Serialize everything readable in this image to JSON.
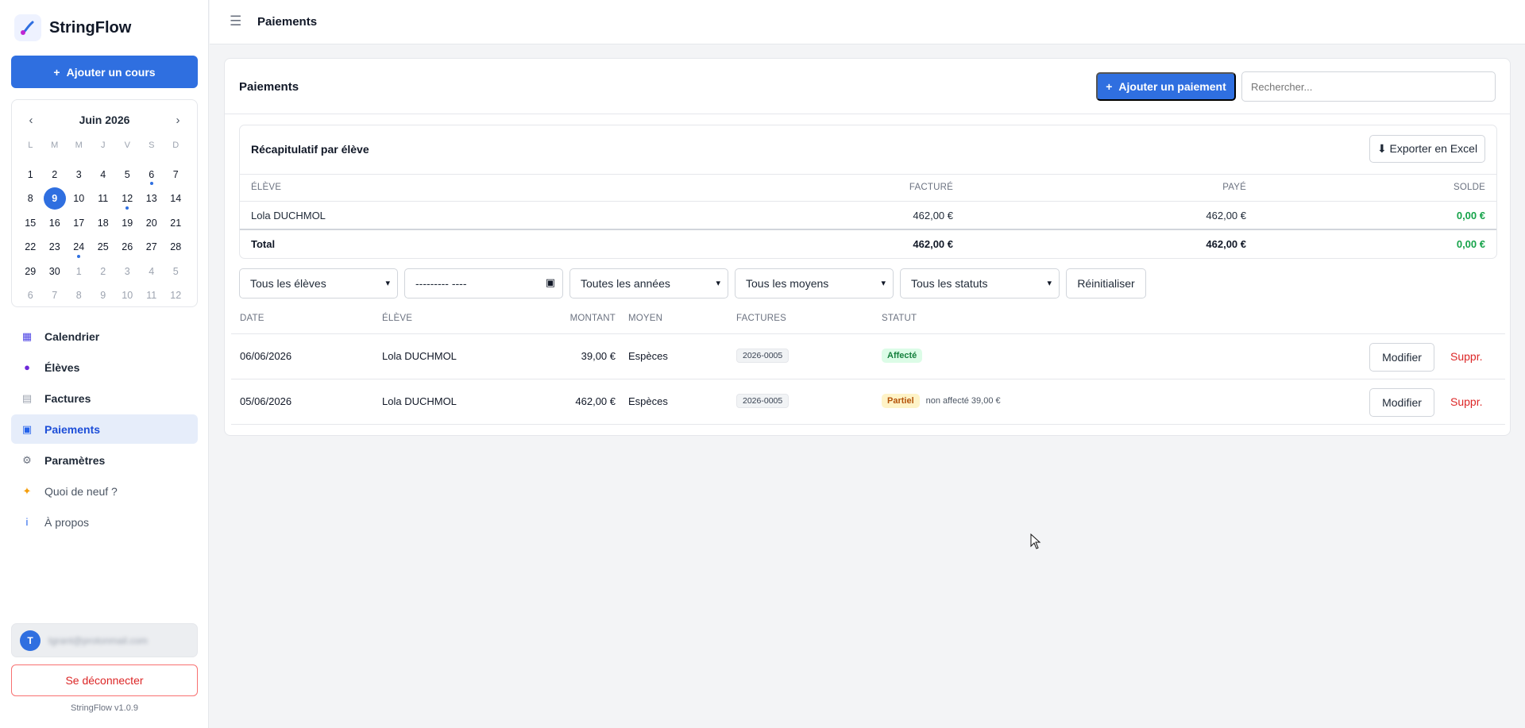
{
  "app": {
    "name": "StringFlow",
    "version": "StringFlow v1.0.9"
  },
  "sidebar": {
    "add_course_label": "Ajouter un cours",
    "calendar": {
      "month_label": "Juin 2026",
      "prev": "‹",
      "next": "›",
      "weekdays": [
        "L",
        "M",
        "M",
        "J",
        "V",
        "S",
        "D"
      ],
      "weeks": [
        [
          {
            "d": "1"
          },
          {
            "d": "2"
          },
          {
            "d": "3"
          },
          {
            "d": "4"
          },
          {
            "d": "5"
          },
          {
            "d": "6",
            "dot": true
          },
          {
            "d": "7"
          }
        ],
        [
          {
            "d": "8"
          },
          {
            "d": "9",
            "today": true
          },
          {
            "d": "10"
          },
          {
            "d": "11"
          },
          {
            "d": "12",
            "dot": true
          },
          {
            "d": "13"
          },
          {
            "d": "14"
          }
        ],
        [
          {
            "d": "15"
          },
          {
            "d": "16"
          },
          {
            "d": "17"
          },
          {
            "d": "18"
          },
          {
            "d": "19"
          },
          {
            "d": "20"
          },
          {
            "d": "21"
          }
        ],
        [
          {
            "d": "22"
          },
          {
            "d": "23"
          },
          {
            "d": "24",
            "dot": true
          },
          {
            "d": "25"
          },
          {
            "d": "26"
          },
          {
            "d": "27"
          },
          {
            "d": "28"
          }
        ],
        [
          {
            "d": "29"
          },
          {
            "d": "30"
          },
          {
            "d": "1",
            "muted": true
          },
          {
            "d": "2",
            "muted": true
          },
          {
            "d": "3",
            "muted": true
          },
          {
            "d": "4",
            "muted": true
          },
          {
            "d": "5",
            "muted": true
          }
        ],
        [
          {
            "d": "6",
            "muted": true
          },
          {
            "d": "7",
            "muted": true
          },
          {
            "d": "8",
            "muted": true
          },
          {
            "d": "9",
            "muted": true
          },
          {
            "d": "10",
            "muted": true
          },
          {
            "d": "11",
            "muted": true
          },
          {
            "d": "12",
            "muted": true
          }
        ]
      ]
    },
    "nav": [
      {
        "label": "Calendrier",
        "icon": "calendar-icon",
        "glyph": "▦",
        "color": "#4f46e5"
      },
      {
        "label": "Élèves",
        "icon": "student-icon",
        "glyph": "●",
        "color": "#6d28d9"
      },
      {
        "label": "Factures",
        "icon": "invoice-icon",
        "glyph": "▤",
        "color": "#9ca3af"
      },
      {
        "label": "Paiements",
        "icon": "payments-icon",
        "glyph": "▣",
        "color": "#2563eb",
        "active": true
      },
      {
        "label": "Paramètres",
        "icon": "gear-icon",
        "glyph": "⚙",
        "color": "#6b7280"
      },
      {
        "label": "Quoi de neuf ?",
        "icon": "sparkle-icon",
        "glyph": "✦",
        "color": "#f59e0b",
        "light": true
      },
      {
        "label": "À propos",
        "icon": "info-icon",
        "glyph": "i",
        "color": "#2563eb",
        "light": true
      }
    ],
    "user": {
      "initial": "T",
      "email": "tgrant@protonmail.com"
    },
    "logout_label": "Se déconnecter"
  },
  "topbar": {
    "title": "Paiements"
  },
  "main": {
    "card_title": "Paiements",
    "add_payment_label": "Ajouter un paiement",
    "search_placeholder": "Rechercher...",
    "summary": {
      "title": "Récapitulatif par élève",
      "export_label": "⬇ Exporter en Excel",
      "headers": [
        "ÉLÈVE",
        "FACTURÉ",
        "PAYÉ",
        "SOLDE"
      ],
      "rows": [
        {
          "student": "Lola DUCHMOL",
          "billed": "462,00 €",
          "paid": "462,00 €",
          "balance": "0,00 €"
        }
      ],
      "total": {
        "label": "Total",
        "billed": "462,00 €",
        "paid": "462,00 €",
        "balance": "0,00 €"
      }
    },
    "filters": {
      "students": "Tous les élèves",
      "month": "--------- ----",
      "years": "Toutes les années",
      "methods": "Tous les moyens",
      "statuses": "Tous les statuts",
      "reset_label": "Réinitialiser"
    },
    "payments": {
      "headers": [
        "DATE",
        "ÉLÈVE",
        "MONTANT",
        "MOYEN",
        "FACTURES",
        "STATUT"
      ],
      "rows": [
        {
          "date": "06/06/2026",
          "student": "Lola DUCHMOL",
          "amount": "39,00 €",
          "method": "Espèces",
          "invoice": "2026-0005",
          "status": "Affecté",
          "status_kind": "ok",
          "note": "",
          "edit": "Modifier",
          "delete": "Suppr."
        },
        {
          "date": "05/06/2026",
          "student": "Lola DUCHMOL",
          "amount": "462,00 €",
          "method": "Espèces",
          "invoice": "2026-0005",
          "status": "Partiel",
          "status_kind": "partial",
          "note": "non affecté 39,00 €",
          "edit": "Modifier",
          "delete": "Suppr."
        }
      ]
    }
  }
}
